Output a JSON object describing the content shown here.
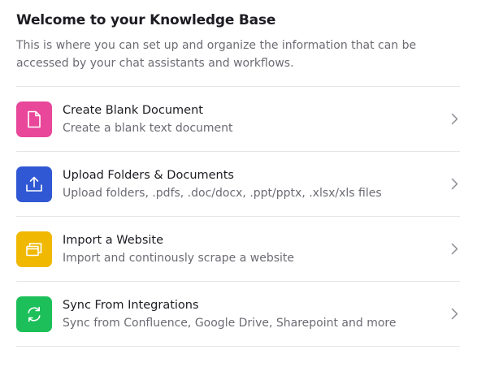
{
  "header": {
    "title": "Welcome to your Knowledge Base",
    "subtitle": "This is where you can set up and organize the information that can be accessed by your chat assistants and workflows."
  },
  "items": [
    {
      "label": "Create Blank Document",
      "description": "Create a blank text document",
      "icon": "document-icon",
      "color": "#e8479a"
    },
    {
      "label": "Upload Folders & Documents",
      "description": "Upload folders, .pdfs, .doc/docx, .ppt/pptx, .xlsx/xls files",
      "icon": "upload-icon",
      "color": "#3057d4"
    },
    {
      "label": "Import a Website",
      "description": "Import and continously scrape a website",
      "icon": "browser-windows-icon",
      "color": "#f0b800"
    },
    {
      "label": "Sync From Integrations",
      "description": "Sync from Confluence, Google Drive, Sharepoint and more",
      "icon": "sync-icon",
      "color": "#1dbf5a"
    }
  ]
}
